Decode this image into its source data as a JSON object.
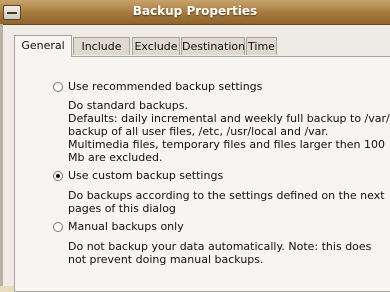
{
  "window": {
    "title": "Backup Properties"
  },
  "tabs": [
    {
      "label": "General"
    },
    {
      "label": "Include"
    },
    {
      "label": "Exclude"
    },
    {
      "label": "Destination"
    },
    {
      "label": "Time"
    }
  ],
  "options": {
    "recommended": {
      "label": "Use recommended backup settings",
      "desc": "Do standard backups.\nDefaults: daily incremental and weekly full backup to /var/\nbackup of all user files, /etc, /usr/local and /var.\nMultimedia files, temporary files and files larger then 100\nMb are excluded."
    },
    "custom": {
      "label": "Use custom backup settings",
      "desc": "Do backups according to the settings defined on the next\npages of this dialog"
    },
    "manual": {
      "label": "Manual backups only",
      "desc": "Do not backup your data automatically. Note: this does\nnot prevent doing manual backups."
    }
  }
}
